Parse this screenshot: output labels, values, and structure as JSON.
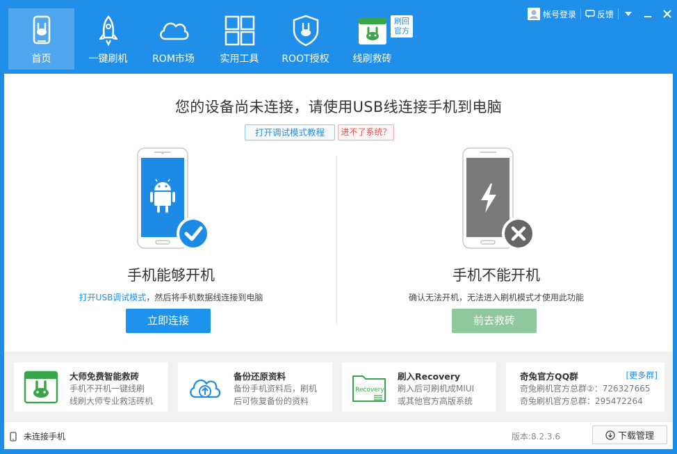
{
  "nav": {
    "items": [
      {
        "label": "首页",
        "icon": "phone-rabbit-icon"
      },
      {
        "label": "一键刷机",
        "icon": "rocket-icon"
      },
      {
        "label": "ROM市场",
        "icon": "cloud-icon"
      },
      {
        "label": "实用工具",
        "icon": "grid-icon"
      },
      {
        "label": "ROOT授权",
        "icon": "shield-rabbit-icon"
      },
      {
        "label": "线刷救砖",
        "icon": "rescue-rabbit-icon"
      }
    ],
    "badge": "刷回官方"
  },
  "window": {
    "login": "帐号登录",
    "feedback": "反馈"
  },
  "main": {
    "headline": "您的设备尚未连接，请使用USB线连接手机到电脑",
    "tutorial_btn": "打开调试模式教程",
    "system_btn": "进不了系统？",
    "left": {
      "title": "手机能够开机",
      "desc_link": "打开USB调试模式",
      "desc_rest": "，然后将手机数据线连接到电脑",
      "button": "立即连接"
    },
    "right": {
      "title": "手机不能开机",
      "desc": "确认无法开机，无法进入刷机模式才使用此功能",
      "button": "前去救砖"
    }
  },
  "cards": [
    {
      "title": "大师免费智能救砖",
      "line1": "手机不开机一键线刷",
      "line2": "线刷大师专业救活砖机"
    },
    {
      "title": "备份还原资料",
      "line1": "备份手机资料后，刷机",
      "line2": "后可恢复备份的资料"
    },
    {
      "title": "刷入Recovery",
      "line1": "刷入后可刷机成MIUI",
      "line2": "或其他官方高版系统",
      "icon_text": "Recovery"
    },
    {
      "title": "奇兔官方QQ群",
      "more": "[更多群]",
      "line1": "奇兔刷机官方总群②：726327665",
      "line2": "奇兔刷机官方总群：295472264"
    }
  ],
  "status": {
    "device": "未连接手机",
    "version": "版本:8.2.3.6",
    "download": "下载管理"
  },
  "colors": {
    "brand_blue": "#1f8fea",
    "connect_blue": "#1e93ee",
    "rescue_green": "#8fc89d",
    "card_green": "#3aa548"
  }
}
